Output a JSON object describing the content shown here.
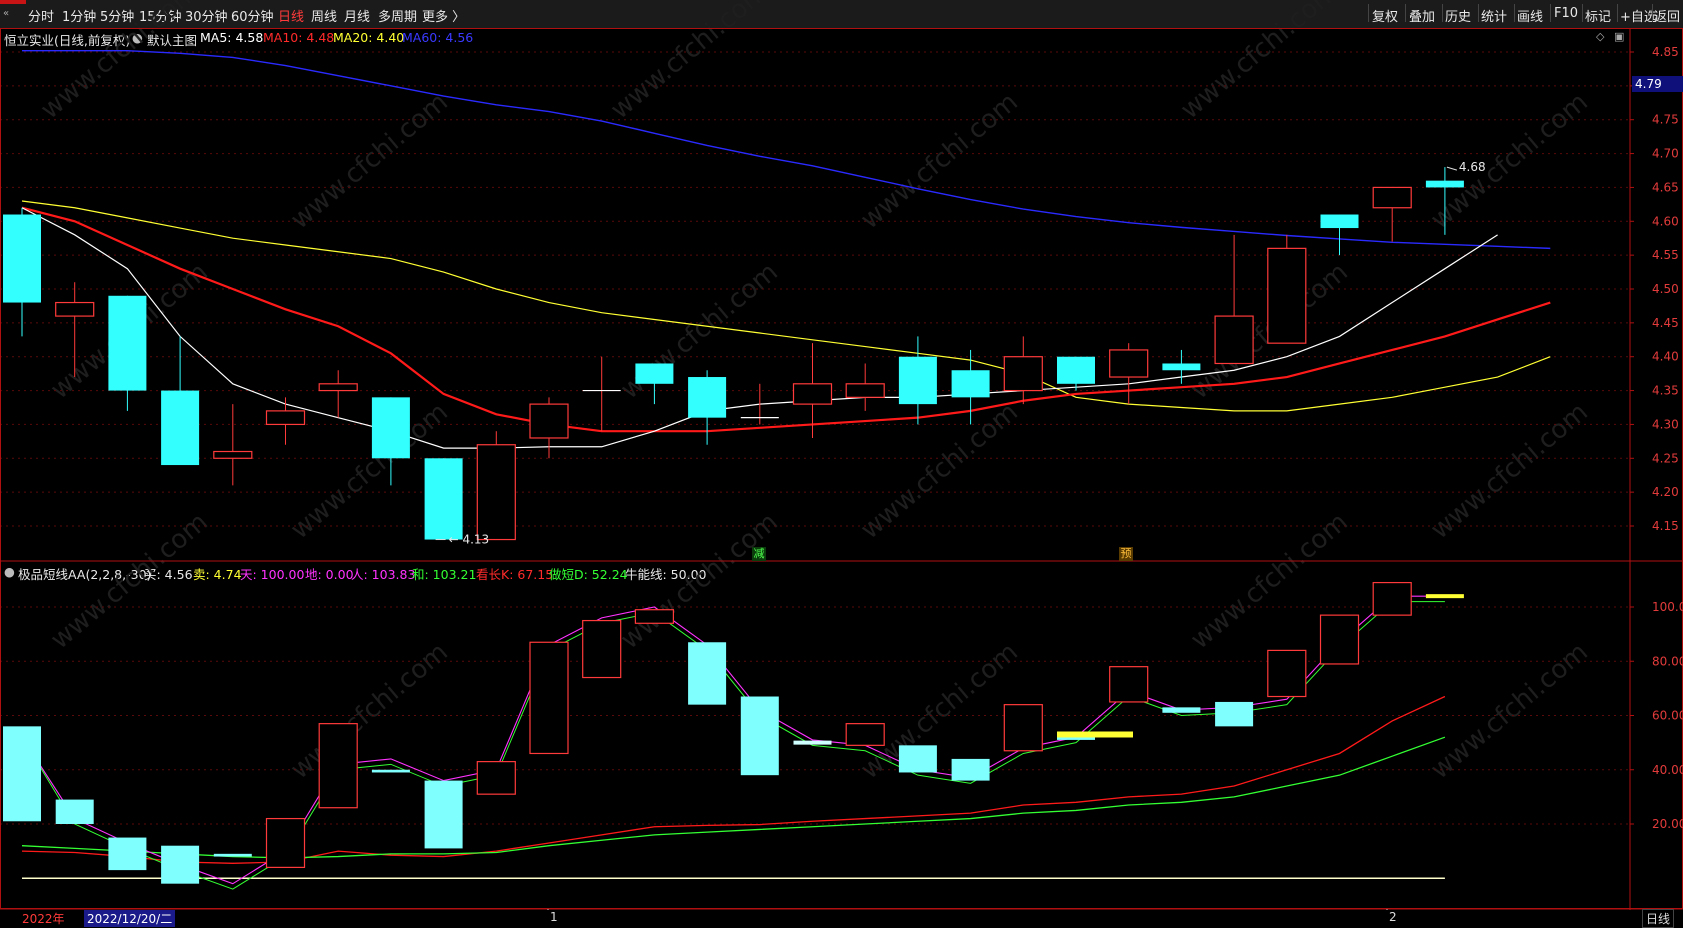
{
  "toolbar": {
    "periods": [
      "分时",
      "1分钟",
      "5分钟",
      "15分钟",
      "30分钟",
      "60分钟",
      "日线",
      "周线",
      "月线",
      "多周期",
      "更多 〉"
    ],
    "active_period": "日线",
    "right_buttons": [
      "复权",
      "叠加",
      "历史",
      "统计",
      "画线",
      "F10",
      "标记",
      "+自选",
      "返回"
    ]
  },
  "main_chart": {
    "stock_name": "恒立实业(日线,前复权)",
    "template": "默认主图",
    "ma5_label": "MA5: 4.58",
    "ma10_label": "MA10: 4.48",
    "ma20_label": "MA20: 4.40",
    "ma60_label": "MA60: 4.56",
    "current_price_tag": "4.79",
    "high_marker": "4.68",
    "low_marker": "4.13",
    "signal_jian": "减",
    "signal_yu": "预",
    "y_ticks": [
      "4.85",
      "4.80",
      "4.75",
      "4.70",
      "4.65",
      "4.60",
      "4.55",
      "4.50",
      "4.45",
      "4.40",
      "4.35",
      "4.30",
      "4.25",
      "4.20",
      "4.15"
    ],
    "colors": {
      "up": "#ff3a3a",
      "down": "#33ffff",
      "ma5": "#ffffff",
      "ma10": "#ff1a1a",
      "ma20": "#ffff33",
      "ma60": "#2a2aff",
      "grid": "#5a0a0a",
      "axis": "#b01010"
    },
    "candles": [
      {
        "o": 4.61,
        "c": 4.48,
        "h": 4.62,
        "l": 4.43
      },
      {
        "o": 4.46,
        "c": 4.48,
        "h": 4.51,
        "l": 4.37
      },
      {
        "o": 4.49,
        "c": 4.35,
        "h": 4.49,
        "l": 4.32
      },
      {
        "o": 4.35,
        "c": 4.24,
        "h": 4.43,
        "l": 4.24
      },
      {
        "o": 4.25,
        "c": 4.26,
        "h": 4.33,
        "l": 4.21
      },
      {
        "o": 4.3,
        "c": 4.32,
        "h": 4.34,
        "l": 4.27
      },
      {
        "o": 4.35,
        "c": 4.36,
        "h": 4.38,
        "l": 4.31
      },
      {
        "o": 4.34,
        "c": 4.25,
        "h": 4.34,
        "l": 4.21
      },
      {
        "o": 4.25,
        "c": 4.13,
        "h": 4.25,
        "l": 4.13
      },
      {
        "o": 4.13,
        "c": 4.27,
        "h": 4.29,
        "l": 4.13
      },
      {
        "o": 4.28,
        "c": 4.33,
        "h": 4.34,
        "l": 4.25
      },
      {
        "o": 4.35,
        "c": 4.35,
        "h": 4.4,
        "l": 4.29
      },
      {
        "o": 4.39,
        "c": 4.36,
        "h": 4.39,
        "l": 4.33
      },
      {
        "o": 4.37,
        "c": 4.31,
        "h": 4.38,
        "l": 4.27
      },
      {
        "o": 4.31,
        "c": 4.31,
        "h": 4.36,
        "l": 4.3
      },
      {
        "o": 4.33,
        "c": 4.36,
        "h": 4.42,
        "l": 4.28
      },
      {
        "o": 4.34,
        "c": 4.36,
        "h": 4.39,
        "l": 4.32
      },
      {
        "o": 4.4,
        "c": 4.33,
        "h": 4.43,
        "l": 4.3
      },
      {
        "o": 4.38,
        "c": 4.34,
        "h": 4.41,
        "l": 4.3
      },
      {
        "o": 4.35,
        "c": 4.4,
        "h": 4.43,
        "l": 4.33
      },
      {
        "o": 4.4,
        "c": 4.36,
        "h": 4.4,
        "l": 4.35
      },
      {
        "o": 4.37,
        "c": 4.41,
        "h": 4.42,
        "l": 4.33
      },
      {
        "o": 4.39,
        "c": 4.38,
        "h": 4.41,
        "l": 4.36
      },
      {
        "o": 4.39,
        "c": 4.46,
        "h": 4.58,
        "l": 4.39
      },
      {
        "o": 4.42,
        "c": 4.56,
        "h": 4.58,
        "l": 4.42
      },
      {
        "o": 4.61,
        "c": 4.59,
        "h": 4.61,
        "l": 4.55
      },
      {
        "o": 4.62,
        "c": 4.65,
        "h": 4.65,
        "l": 4.57
      },
      {
        "o": 4.66,
        "c": 4.65,
        "h": 4.68,
        "l": 4.58
      }
    ],
    "ma5": [
      4.62,
      4.58,
      4.53,
      4.43,
      4.36,
      4.33,
      4.31,
      4.29,
      4.265,
      4.265,
      4.267,
      4.267,
      4.29,
      4.32,
      4.33,
      4.335,
      4.34,
      4.34,
      4.345,
      4.35,
      4.355,
      4.36,
      4.37,
      4.38,
      4.4,
      4.43,
      4.48,
      4.53,
      4.58
    ],
    "ma10": [
      4.62,
      4.6,
      4.565,
      4.53,
      4.5,
      4.47,
      4.445,
      4.405,
      4.345,
      4.315,
      4.3,
      4.29,
      4.29,
      4.29,
      4.295,
      4.3,
      4.305,
      4.31,
      4.32,
      4.335,
      4.345,
      4.35,
      4.355,
      4.36,
      4.37,
      4.39,
      4.41,
      4.43,
      4.455,
      4.48
    ],
    "ma20": [
      4.63,
      4.62,
      4.605,
      4.59,
      4.575,
      4.565,
      4.555,
      4.545,
      4.525,
      4.5,
      4.48,
      4.465,
      4.455,
      4.445,
      4.435,
      4.425,
      4.415,
      4.405,
      4.395,
      4.375,
      4.34,
      4.33,
      4.325,
      4.32,
      4.32,
      4.33,
      4.34,
      4.355,
      4.37,
      4.4
    ],
    "ma60": [
      4.852,
      4.852,
      4.852,
      4.848,
      4.842,
      4.83,
      4.815,
      4.8,
      4.785,
      4.772,
      4.762,
      4.748,
      4.73,
      4.712,
      4.696,
      4.682,
      4.665,
      4.648,
      4.632,
      4.618,
      4.607,
      4.598,
      4.591,
      4.585,
      4.579,
      4.574,
      4.569,
      4.566,
      4.563,
      4.56
    ]
  },
  "indicator": {
    "name": "极品短线AA(2,2,8,-30)",
    "buy_label": "买: 4.56",
    "sell_label": "卖: 4.74",
    "tian_label": "天: 100.00",
    "di_label": "地: 0.00",
    "ren_label": "人: 103.83",
    "he_label": "和: 103.21",
    "zengzhang_label": "看长K: 67.15",
    "duanxian_label": "做短D: 52.24",
    "niuneng_label": "牛能线: 50.00",
    "y_ticks": [
      "100.0",
      "80.00",
      "60.00",
      "40.00",
      "20.00"
    ],
    "boxes": [
      {
        "o": 56,
        "c": 21
      },
      {
        "o": 29,
        "c": 20
      },
      {
        "o": 15,
        "c": 3
      },
      {
        "o": 12,
        "c": -2
      },
      {
        "o": 9,
        "c": 8
      },
      {
        "o": 4,
        "c": 22
      },
      {
        "o": 26,
        "c": 57
      },
      {
        "o": 40,
        "c": 39
      },
      {
        "o": 36,
        "c": 11
      },
      {
        "o": 31,
        "c": 43
      },
      {
        "o": 46,
        "c": 87
      },
      {
        "o": 74,
        "c": 95
      },
      {
        "o": 94,
        "c": 99
      },
      {
        "o": 87,
        "c": 64
      },
      {
        "o": 67,
        "c": 38
      },
      {
        "o": 50,
        "c": 50
      },
      {
        "o": 49,
        "c": 57
      },
      {
        "o": 49,
        "c": 39
      },
      {
        "o": 44,
        "c": 36
      },
      {
        "o": 47,
        "c": 64
      },
      {
        "o": 53,
        "c": 51
      },
      {
        "o": 65,
        "c": 78
      },
      {
        "o": 63,
        "c": 61
      },
      {
        "o": 65,
        "c": 56
      },
      {
        "o": 67,
        "c": 84
      },
      {
        "o": 79,
        "c": 97
      },
      {
        "o": 97,
        "c": 109
      },
      {
        "o": 104,
        "c": 104
      }
    ],
    "k_line": [
      10,
      9.5,
      8,
      6,
      5.5,
      6,
      10,
      8.5,
      8,
      10,
      13,
      16,
      19,
      19.5,
      19.8,
      21,
      22,
      23,
      24,
      27,
      28,
      30,
      31,
      34,
      40,
      46,
      58,
      67
    ],
    "d_line": [
      12,
      11,
      10,
      9,
      8,
      7.5,
      8,
      9,
      9,
      9.5,
      12,
      14,
      16,
      17,
      18,
      19,
      20,
      21,
      22,
      24,
      25,
      27,
      28,
      30,
      34,
      38,
      45,
      52
    ],
    "m_line": [
      52,
      22,
      13,
      5,
      -2,
      10,
      42,
      44,
      36,
      40,
      86,
      96,
      100,
      86,
      62,
      51,
      49,
      40,
      37,
      48,
      52,
      69,
      62,
      63,
      66,
      87,
      104,
      104
    ]
  },
  "xaxis": {
    "year_label": "2022年",
    "cursor_date": "2022/12/20/二",
    "month_marks": [
      "1",
      "2"
    ],
    "period_button": "日线"
  },
  "watermark": "www.cfchi.com"
}
